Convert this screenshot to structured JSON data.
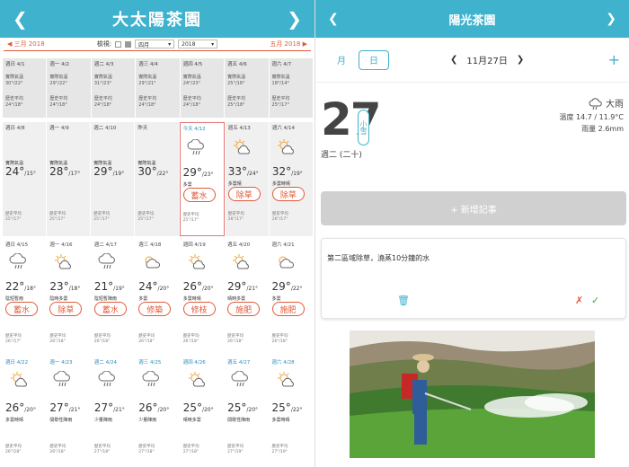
{
  "left": {
    "title": "大太陽茶園",
    "prev_month": "三月 2018",
    "next_month": "五月 2018",
    "view_label": "檢視:",
    "month_select": "四月",
    "year_select": "2018",
    "weeks": [
      {
        "days": [
          {
            "label": "週日 4/1",
            "note": "實際氣溫",
            "val": "30°/22°",
            "hist": "歷史平均",
            "hv": "24°/18°"
          },
          {
            "label": "週一 4/2",
            "note": "實際氣溫",
            "val": "29°/22°",
            "hist": "歷史平均",
            "hv": "24°/18°"
          },
          {
            "label": "週二 4/3",
            "note": "實際氣溫",
            "val": "31°/23°",
            "hist": "歷史平均",
            "hv": "24°/18°"
          },
          {
            "label": "週三 4/4",
            "note": "實際氣溫",
            "val": "29°/21°",
            "hist": "歷史平均",
            "hv": "24°/18°"
          },
          {
            "label": "週四 4/5",
            "note": "實際氣溫",
            "val": "24°/23°",
            "hist": "歷史平均",
            "hv": "24°/18°"
          },
          {
            "label": "週五 4/6",
            "note": "實際氣溫",
            "val": "25°/16°",
            "hist": "歷史平均",
            "hv": "25°/18°"
          },
          {
            "label": "週六 4/7",
            "note": "實際氣溫",
            "val": "18°/14°",
            "hist": "歷史平均",
            "hv": "25°/17°"
          }
        ]
      },
      {
        "days": [
          {
            "label": "週日 4/8",
            "note": "實際氣溫",
            "t": "24°",
            "lo": "/15°",
            "hist": "歷史平均",
            "hv": "25°/17°"
          },
          {
            "label": "週一 4/9",
            "note": "實際氣溫",
            "t": "28°",
            "lo": "/17°",
            "hist": "歷史平均",
            "hv": "25°/17°"
          },
          {
            "label": "週二 4/10",
            "note": "實際氣溫",
            "t": "29°",
            "lo": "/19°",
            "hist": "歷史平均",
            "hv": "25°/17°"
          },
          {
            "label": "昨天",
            "note": "實際氣溫",
            "t": "30°",
            "lo": "/22°",
            "hist": "歷史平均",
            "hv": "25°/17°"
          },
          {
            "label": "今天 4/12",
            "t": "29°",
            "lo": "/23°",
            "cond": "多雲",
            "tag": "蓄水",
            "hist": "歷史平均",
            "hv": "25°/17°",
            "icon": "rain",
            "today": true
          },
          {
            "label": "週五 4/13",
            "t": "33°",
            "lo": "/24°",
            "cond": "多雲晴",
            "tag": "除草",
            "hist": "歷史平均",
            "hv": "26°/17°",
            "icon": "sun-cloud"
          },
          {
            "label": "週六 4/14",
            "t": "32°",
            "lo": "/19°",
            "cond": "多雲時晴",
            "tag": "除草",
            "hist": "歷史平均",
            "hv": "26°/17°",
            "icon": "sun-cloud"
          }
        ]
      },
      {
        "days": [
          {
            "label": "週日 4/15",
            "t": "22°",
            "lo": "/18°",
            "cond": "陰短暫雨",
            "tag": "蓄水",
            "hist": "歷史平均",
            "hv": "26°/17°",
            "icon": "rain"
          },
          {
            "label": "週一 4/16",
            "t": "23°",
            "lo": "/18°",
            "cond": "陰時多雲",
            "tag": "除草",
            "hist": "歷史平均",
            "hv": "26°/18°",
            "icon": "sun-cloud"
          },
          {
            "label": "週二 4/17",
            "t": "21°",
            "lo": "/19°",
            "cond": "陰短暫陣雨",
            "tag": "蓄水",
            "hist": "歷史平均",
            "hv": "26°/18°",
            "icon": "rain"
          },
          {
            "label": "週三 4/18",
            "t": "24°",
            "lo": "/20°",
            "cond": "多雲",
            "tag": "修築",
            "hist": "歷史平均",
            "hv": "26°/18°",
            "icon": "cloud-sun"
          },
          {
            "label": "週四 4/19",
            "t": "26°",
            "lo": "/20°",
            "cond": "多雲時晴",
            "tag": "修枝",
            "hist": "歷史平均",
            "hv": "26°/18°",
            "icon": "sun-cloud"
          },
          {
            "label": "週五 4/20",
            "t": "29°",
            "lo": "/21°",
            "cond": "晴時多雲",
            "tag": "施肥",
            "hist": "歷史平均",
            "hv": "26°/18°",
            "icon": "sun-cloud"
          },
          {
            "label": "週六 4/21",
            "t": "29°",
            "lo": "/22°",
            "cond": "多雲",
            "tag": "施肥",
            "hist": "歷史平均",
            "hv": "26°/18°",
            "icon": "cloud-sun"
          }
        ]
      },
      {
        "days": [
          {
            "label": "週日 4/22",
            "t": "26°",
            "lo": "/20°",
            "cond": "多雲時晴",
            "hist": "歷史平均",
            "hv": "26°/18°",
            "icon": "sun-cloud"
          },
          {
            "label": "週一 4/23",
            "t": "27°",
            "lo": "/21°",
            "cond": "間歇性陣雨",
            "hist": "歷史平均",
            "hv": "26°/18°",
            "icon": "rain"
          },
          {
            "label": "週二 4/24",
            "t": "27°",
            "lo": "/21°",
            "cond": "少量陣雨",
            "hist": "歷史平均",
            "hv": "27°/18°",
            "icon": "rain"
          },
          {
            "label": "週三 4/25",
            "t": "26°",
            "lo": "/20°",
            "cond": "少量陣雨",
            "hist": "歷史平均",
            "hv": "27°/18°",
            "icon": "rain"
          },
          {
            "label": "週四 4/26",
            "t": "25°",
            "lo": "/20°",
            "cond": "晴時多雲",
            "hist": "歷史平均",
            "hv": "27°/18°",
            "icon": "sun-cloud"
          },
          {
            "label": "週五 4/27",
            "t": "25°",
            "lo": "/20°",
            "cond": "間歇性陣雨",
            "hist": "歷史平均",
            "hv": "27°/19°",
            "icon": "rain"
          },
          {
            "label": "週六 4/28",
            "t": "25°",
            "lo": "/22°",
            "cond": "多雲時晴",
            "hist": "歷史平均",
            "hv": "27°/19°",
            "icon": "sun-cloud"
          }
        ]
      }
    ]
  },
  "right": {
    "title": "陽光茶園",
    "tab_month": "月",
    "tab_day": "日",
    "date_nav": "11月27日",
    "day_num": "27",
    "solar_term": "小雪",
    "weekday": "週二 (二十)",
    "weather": "大雨",
    "temp_line": "溫度 14.7 / 11.9°C",
    "rain_line": "雨量 2.6mm",
    "add_note": "+ 新增記事",
    "note_text": "第二區域除草，澆蒸10分鐘的水"
  },
  "colors": {
    "header": "#3fb2ce",
    "accent": "#e05a3a",
    "ok": "#3aa94e"
  }
}
